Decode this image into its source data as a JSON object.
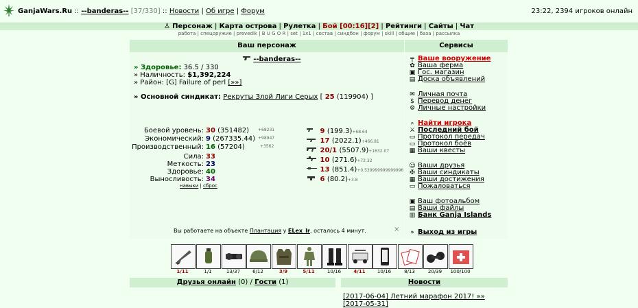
{
  "topbar": {
    "site": "GanjaWars.Ru",
    "sep1": "::",
    "user": "--banderas--",
    "level_bracket": "[37/330]",
    "sep2": "::",
    "links": [
      "Новости",
      "Об игре",
      "Форум"
    ],
    "right": "23:22, 2394 игроков онлайн"
  },
  "nav": {
    "items": [
      "Персонаж",
      "Карта острова",
      "Рулетка",
      "Бой [00:16][2]",
      "Рейтинги",
      "Сайты",
      "Чат"
    ],
    "sub": [
      "работа",
      "спецоружие",
      "prevedik",
      "B U G O R",
      "set",
      "1x1",
      "состав",
      "синдбон",
      "форум",
      "skill",
      "общие",
      "база",
      "рассылка"
    ]
  },
  "character": {
    "panel_title": "Ваш персонаж",
    "name": "--banderas--",
    "health_label": "» Здоровье:",
    "health_value": "36.5 / 330",
    "cash_label": "» Наличность:",
    "cash_value": "$1,392,224",
    "district_label": "» Район:",
    "district_value": "[G] Failure of perl",
    "district_link": "[»»]",
    "syndicate_label": "» Основной синдикат:",
    "syndicate_name": "Рекруты Злой Лиги Серых",
    "syndicate_level_open": "[",
    "syndicate_level": "25",
    "syndicate_points": "(119904)",
    "syndicate_level_close": "]"
  },
  "levels": [
    {
      "label": "Боевой уровень:",
      "level": "30",
      "exp": "(351482)",
      "delta": "+68231"
    },
    {
      "label": "Экономический:",
      "level": "9",
      "exp": "(267335.44)",
      "delta": "+98947"
    },
    {
      "label": "Производственный:",
      "level": "16",
      "exp": "(57204)",
      "delta": "+3562"
    }
  ],
  "attrs": [
    {
      "label": "Сила:",
      "value": "33"
    },
    {
      "label": "Меткость:",
      "value": "23"
    },
    {
      "label": "Здоровье:",
      "value": "40"
    },
    {
      "label": "Выносливость:",
      "value": "34"
    }
  ],
  "attr_links": [
    "навыки",
    "сброс"
  ],
  "skills": [
    {
      "level": "9",
      "exp": "(199.3)",
      "delta": "+68.64"
    },
    {
      "level": "17",
      "exp": "(2022.1)",
      "delta": "+466.81"
    },
    {
      "level": "20/1",
      "exp": "(5507.9)",
      "delta": "+1632.07"
    },
    {
      "level": "10",
      "exp": "(271.6)",
      "delta": "+72.32"
    },
    {
      "level": "13",
      "exp": "(851.4)",
      "delta": "+0.539999999999996"
    },
    {
      "level": "6",
      "exp": "(80.2)",
      "delta": "+3.8"
    }
  ],
  "work": {
    "prefix": "Вы работаете на объекте",
    "object": "Плантация",
    "middle": "у",
    "owner": "ELex_Ir",
    "suffix": ", осталось 4 минут.",
    "close": "×"
  },
  "services": {
    "title": "Сервисы",
    "groups": [
      [
        {
          "label": "Ваше вооружение",
          "icon": "gun-icon",
          "style": "red"
        },
        {
          "label": "Ваша ферма",
          "icon": "farm-icon",
          "style": "normal"
        },
        {
          "label": "Гос. магазин",
          "icon": "shop-icon",
          "style": "normal"
        },
        {
          "label": "Доска объявлений",
          "icon": "board-icon",
          "style": "normal"
        }
      ],
      [
        {
          "label": "Личная почта",
          "icon": "mail-icon",
          "style": "normal"
        },
        {
          "label": "Перевод денег",
          "icon": "money-icon",
          "style": "normal"
        },
        {
          "label": "Личные настройки",
          "icon": "settings-icon",
          "style": "normal"
        }
      ],
      [
        {
          "label": "Найти игрока",
          "icon": "search-icon",
          "style": "red"
        },
        {
          "label": "Последний бой",
          "icon": "battle-icon",
          "style": "bold"
        },
        {
          "label": "Протокол передач",
          "icon": "protocol-icon",
          "style": "normal"
        },
        {
          "label": "Протокол боёв",
          "icon": "protocol-icon",
          "style": "normal"
        },
        {
          "label": "Ваши квесты",
          "icon": "quest-icon",
          "style": "normal"
        }
      ],
      [
        {
          "label": "Ваши друзья",
          "icon": "friends-icon",
          "style": "normal"
        },
        {
          "label": "Ваши синдикаты",
          "icon": "syndicate-icon",
          "style": "normal"
        },
        {
          "label": "Ваши достижения",
          "icon": "achievement-icon",
          "style": "normal"
        },
        {
          "label": "Пожаловаться",
          "icon": "complain-icon",
          "style": "normal"
        }
      ],
      [
        {
          "label": "Ваш фотоальбом",
          "icon": "photo-icon",
          "style": "normal"
        },
        {
          "label": "Ваши файлы",
          "icon": "files-icon",
          "style": "normal"
        },
        {
          "label": "Банк Ganja Islands",
          "icon": "bank-icon",
          "style": "bold"
        }
      ],
      [
        {
          "label": "Выход из игры",
          "icon": "exit-icon",
          "style": "bold"
        }
      ]
    ]
  },
  "inventory": [
    {
      "item": "rifle-icon",
      "durability": "1/11",
      "red": true
    },
    {
      "item": "grenade-icon",
      "durability": "1/1",
      "red": false
    },
    {
      "item": "scope-icon",
      "durability": "13/37",
      "red": false
    },
    {
      "item": "helmet-icon",
      "durability": "6/12",
      "red": false
    },
    {
      "item": "vest-icon",
      "durability": "3/9",
      "red": true
    },
    {
      "item": "suit-icon",
      "durability": "5/11",
      "red": true
    },
    {
      "item": "boots-icon",
      "durability": "10/16",
      "red": false
    },
    {
      "item": "buggy-icon",
      "durability": "4/11",
      "red": true
    },
    {
      "item": "phone-icon",
      "durability": "10/16",
      "red": false
    },
    {
      "item": "cards-icon",
      "durability": "8/13",
      "red": false
    },
    {
      "item": "binoculars-icon",
      "durability": "20/39",
      "red": false
    },
    {
      "item": "medkit-icon",
      "durability": "100/100",
      "red": false
    }
  ],
  "bottom": {
    "friends_label": "Друзья онлайн",
    "friends_count": "(0)",
    "slash": "/",
    "guests_label": "Гости",
    "guests_count": "(1)",
    "news_title": "Новости",
    "news": [
      "[2017-06-04] Летний марафон 2017! »»",
      "[2017-05-31]"
    ]
  }
}
